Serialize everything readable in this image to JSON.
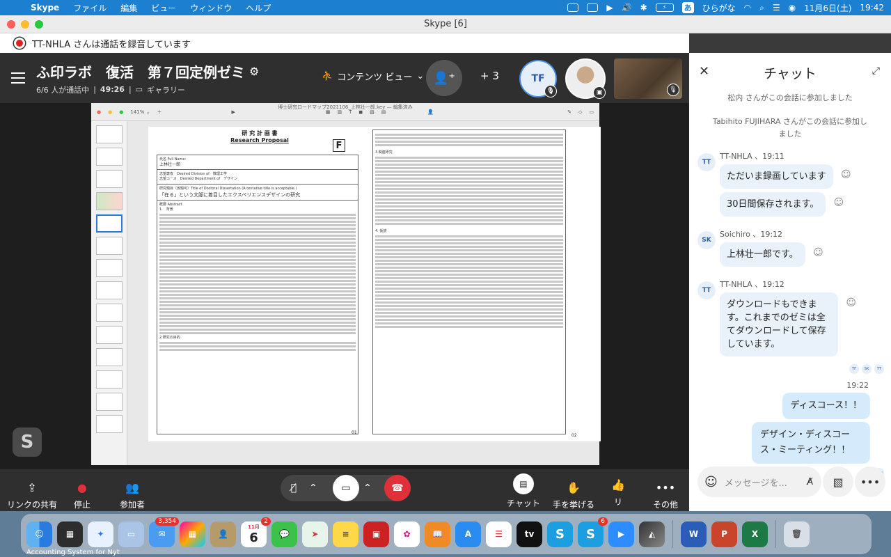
{
  "menubar": {
    "app_name": "Skype",
    "menus": [
      "ファイル",
      "編集",
      "ビュー",
      "ウィンドウ",
      "ヘルプ"
    ],
    "ime_label": "あ",
    "ime_text": "ひらがな",
    "date": "11月6日(土)",
    "time": "19:42",
    "battery": "⚡"
  },
  "window": {
    "title": "Skype [6]"
  },
  "recording_banner": {
    "text": "TT-NHLA さんは通話を録音しています"
  },
  "call": {
    "title": "ふ印ラボ　復活　第７回定例ゼミ",
    "participants_status": "6/6 人が通話中",
    "duration": "49:26",
    "gallery_label": "ギャラリー",
    "view_label": "コンテンツ ビュー",
    "extra_count": "+ 3",
    "avatar_initials": "TF"
  },
  "presentation": {
    "window_title": "博士研究ロードマップ2021106_上林壮一郎.key — 編集済み",
    "zoom": "141% ⌄",
    "doc_title_jp": "研 究 計 画 書",
    "doc_title_en": "Research Proposal",
    "doc_letter": "F",
    "name_label": "氏名 Full Name:",
    "name_value": "上林壮一郎",
    "division_label": "志望専攻　Desired Division of　数理工学",
    "dept_label": "志望コース　Desired Department of　デザイン",
    "thesis_label": "研究題目（仮題可）Title of Doctoral Dissertation (A tentative title is acceptable.)",
    "thesis_title": "「在る」という文脈に着目したエクスペリエンスデザインの研究",
    "abstract_label": "概要 Abstract",
    "section1": "1.　背景",
    "section2": "2.研究の目的",
    "section3": "3.関連研究",
    "section4": "4. 仮説",
    "page_left": "01",
    "page_right": "02"
  },
  "controls": {
    "share_link": "リンクの共有",
    "stop": "停止",
    "participants": "参加者",
    "chat": "チャット",
    "raise_hand": "手を挙げる",
    "react": "リ",
    "more": "その他"
  },
  "chat": {
    "title": "チャット",
    "system_messages": [
      "松内 さんがこの会話に参加しました",
      "Tabihito FUJIHARA さんがこの会話に参加しました"
    ],
    "groups": [
      {
        "initials": "TT",
        "meta": "TT-NHLA 、19:11",
        "messages": [
          "ただいま録画しています",
          "30日間保存されます。"
        ]
      },
      {
        "initials": "SK",
        "meta": "Soichiro 、19:12",
        "messages": [
          "上林壮一郎です。"
        ]
      },
      {
        "initials": "TT",
        "meta": "TT-NHLA 、19:12",
        "messages": [
          "ダウンロードもできます。これまでのゼミは全てダウンロードして保存しています。"
        ]
      }
    ],
    "read_receipts": [
      "TF",
      "SK",
      "TT"
    ],
    "my_time": "19:22",
    "my_messages": [
      "ディスコース！！",
      "デザイン・ディスコース・ミーティング！！"
    ],
    "my_read": "松内",
    "composer_placeholder": "メッセージを..."
  },
  "dock": {
    "mail_badge": "3,354",
    "calendar_month": "11月",
    "calendar_day": "6",
    "calendar_badge": "2",
    "skype_badge": "6",
    "under_text": "Accounting System for Nyt"
  }
}
